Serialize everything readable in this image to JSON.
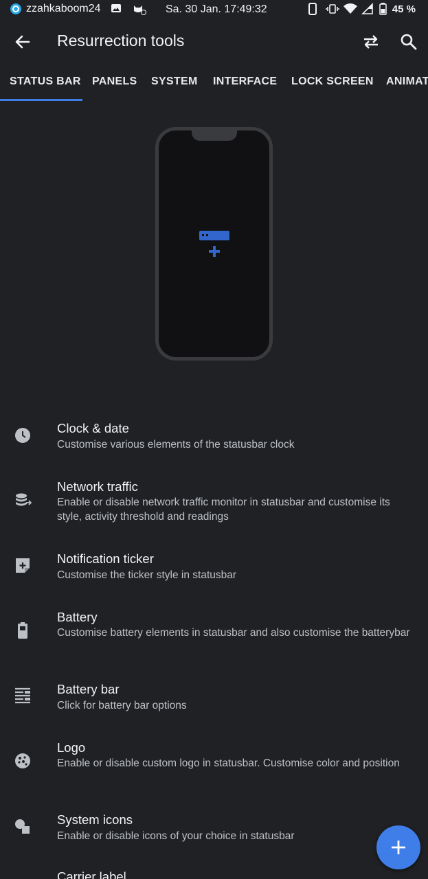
{
  "status_bar": {
    "username": "zzahkaboom24",
    "datetime": "Sa. 30 Jan. 17:49:32",
    "battery": "45 %",
    "icons": [
      "app-icon",
      "image-icon",
      "cat-icon",
      "phone-icon",
      "vibrate-icon",
      "wifi-icon",
      "signal-icon",
      "battery-icon"
    ]
  },
  "app_bar": {
    "title": "Resurrection tools",
    "icons": [
      "back-arrow-icon",
      "swap-icon",
      "search-icon"
    ]
  },
  "tabs": [
    {
      "label": "STATUS BAR",
      "selected": true
    },
    {
      "label": "PANELS"
    },
    {
      "label": "SYSTEM"
    },
    {
      "label": "INTERFACE"
    },
    {
      "label": "LOCK SCREEN"
    },
    {
      "label": "ANIMAT"
    }
  ],
  "items": [
    {
      "title": "Clock & date",
      "subtitle": "Customise various elements of the statusbar clock",
      "icon": "clock-icon"
    },
    {
      "title": "Network traffic",
      "subtitle": "Enable or disable network traffic monitor in statusbar and customise its style, activity threshold and readings",
      "icon": "network-traffic-icon"
    },
    {
      "title": "Notification ticker",
      "subtitle": "Customise the ticker style in statusbar",
      "icon": "notification-ticker-icon"
    },
    {
      "title": "Battery",
      "subtitle": "Customise battery elements in statusbar and also customise the batterybar",
      "icon": "battery-icon"
    },
    {
      "title": "Battery bar",
      "subtitle": "Click for battery bar options",
      "icon": "battery-bar-icon"
    },
    {
      "title": "Logo",
      "subtitle": "Enable or disable custom logo in statusbar. Customise color and position",
      "icon": "logo-icon"
    },
    {
      "title": "System icons",
      "subtitle": "Enable or disable icons of your choice in statusbar",
      "icon": "system-icons-icon"
    },
    {
      "title": "Carrier label",
      "subtitle": "",
      "icon": "carrier-label-icon"
    }
  ],
  "colors": {
    "background": "#202124",
    "accent": "#3f7ee8",
    "text_primary": "#f1f3f4",
    "text_secondary": "#bdc1c6",
    "icon": "#bdc1c6"
  }
}
